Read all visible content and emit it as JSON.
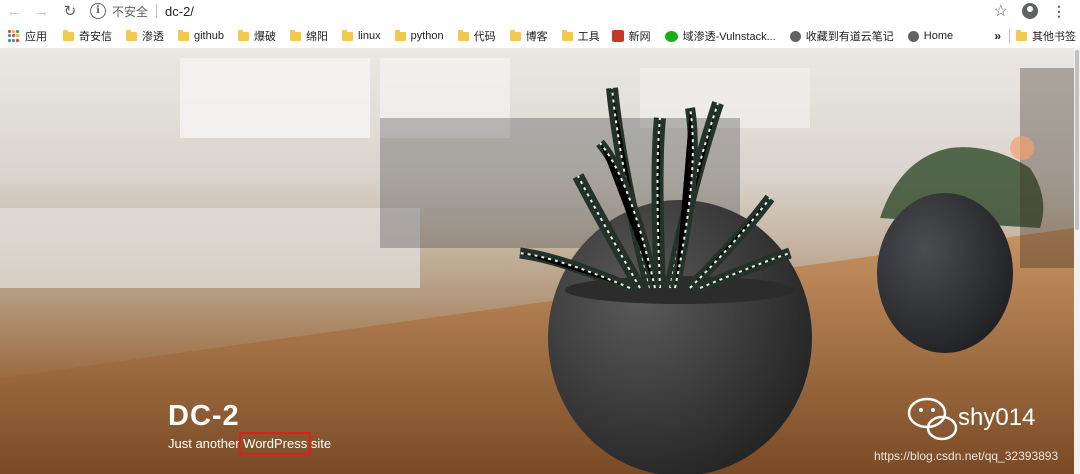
{
  "browser": {
    "security_label": "不安全",
    "url": "dc-2/"
  },
  "bookmarks": [
    {
      "label": "应用",
      "icon": "apps-icon"
    },
    {
      "label": "奇安信",
      "icon": "folder-icon"
    },
    {
      "label": "渗透",
      "icon": "folder-icon"
    },
    {
      "label": "github",
      "icon": "folder-icon"
    },
    {
      "label": "爆破",
      "icon": "folder-icon"
    },
    {
      "label": "绵阳",
      "icon": "folder-icon"
    },
    {
      "label": "linux",
      "icon": "folder-icon"
    },
    {
      "label": "python",
      "icon": "folder-icon"
    },
    {
      "label": "代码",
      "icon": "folder-icon"
    },
    {
      "label": "博客",
      "icon": "folder-icon"
    },
    {
      "label": "工具",
      "icon": "folder-icon"
    },
    {
      "label": "新网",
      "icon": "site-icon"
    },
    {
      "label": "域渗透-Vulnstack...",
      "icon": "wechat-icon"
    },
    {
      "label": "收藏到有道云笔记",
      "icon": "globe-icon"
    },
    {
      "label": "Home",
      "icon": "globe-icon"
    }
  ],
  "bookmarks_overflow": "»",
  "other_bookmarks": "其他书签",
  "site": {
    "title": "DC-2",
    "tagline_before": "Just another ",
    "tagline_highlight": "WordPress",
    "tagline_after": " site"
  },
  "watermark": {
    "name": "shy014",
    "url": "https://blog.csdn.net/qq_32393893"
  },
  "colors": {
    "highlight_box": "#e31c1c",
    "folder": "#f2c94c"
  }
}
